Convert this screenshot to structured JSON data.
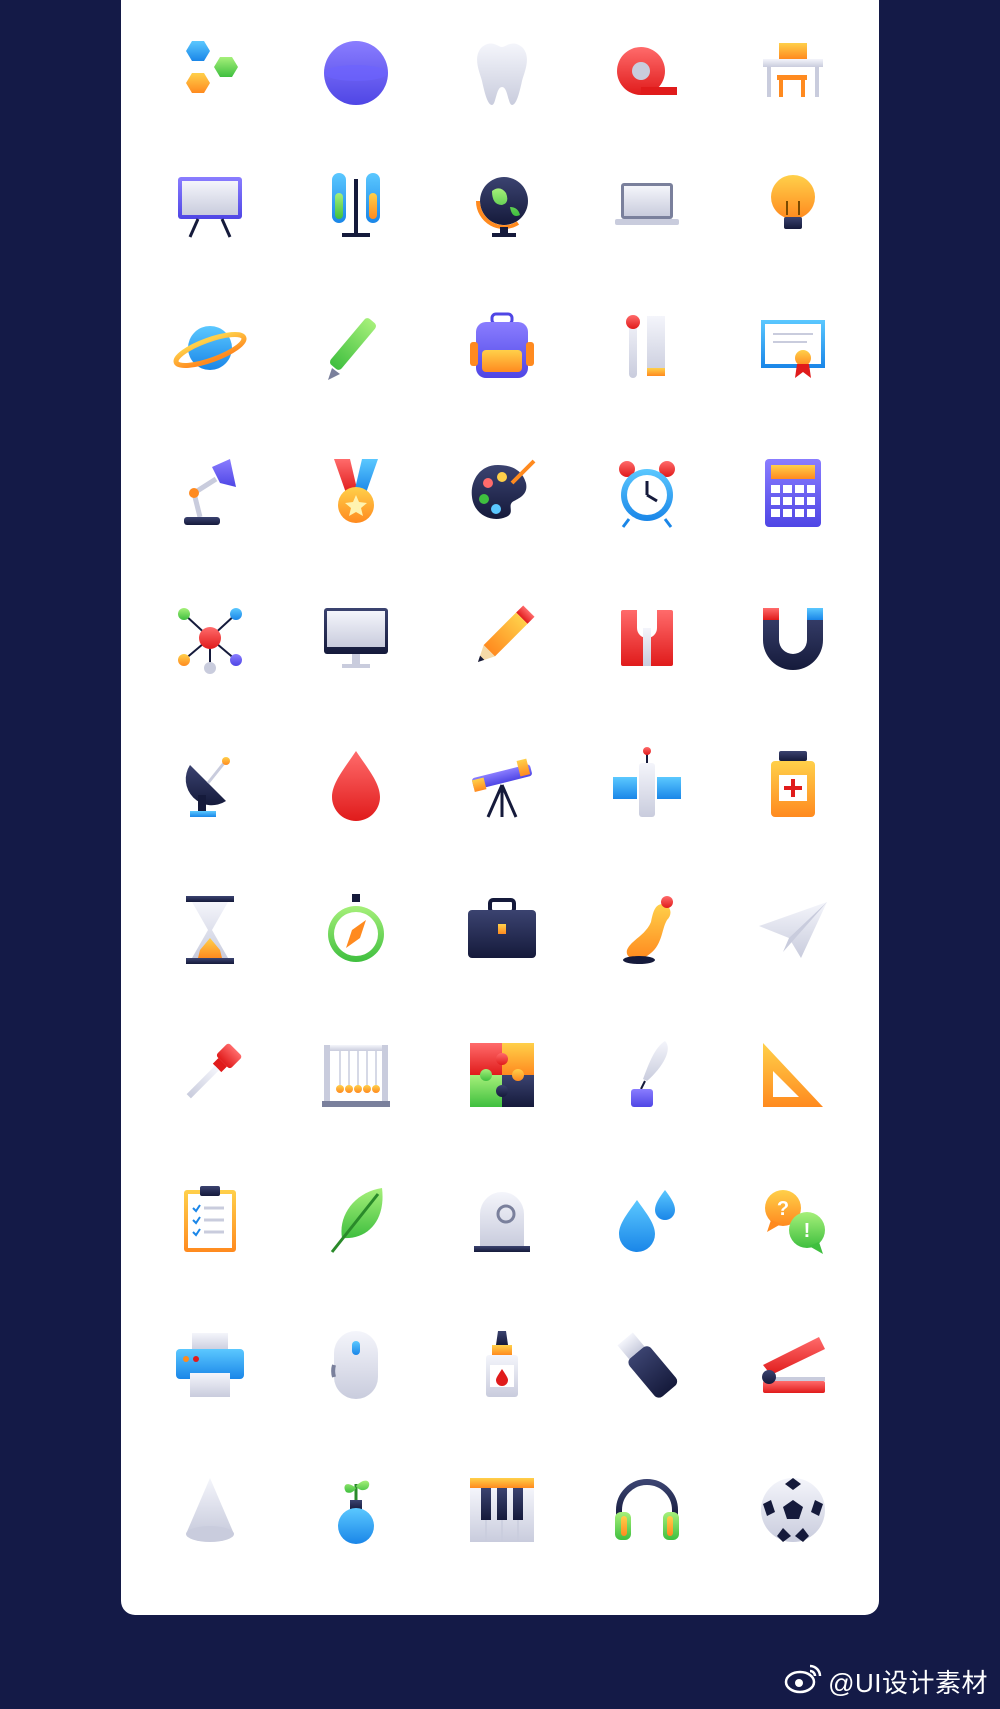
{
  "theme": {
    "background": "#141a47",
    "card": "#ffffff"
  },
  "watermark": {
    "text": "@UI设计素材",
    "icon": "weibo-icon"
  },
  "icons": [
    "hexagons-icon",
    "sphere-icon",
    "tooth-icon",
    "tape-icon",
    "desk-icon",
    "whiteboard-icon",
    "test-tubes-icon",
    "globe-icon",
    "laptop-icon",
    "lightbulb-icon",
    "planet-icon",
    "pen-icon",
    "backpack-icon",
    "thermometer-ruler-icon",
    "certificate-icon",
    "desk-lamp-icon",
    "medal-icon",
    "paint-palette-icon",
    "alarm-clock-icon",
    "calculator-icon",
    "molecule-icon",
    "monitor-icon",
    "pencil-icon",
    "sharpener-icon",
    "magnet-icon",
    "satellite-dish-icon",
    "blood-drop-icon",
    "telescope-icon",
    "satellite-icon",
    "medicine-jar-icon",
    "hourglass-icon",
    "compass-icon",
    "briefcase-icon",
    "rubber-chicken-icon",
    "paper-plane-icon",
    "pipette-icon",
    "newtons-cradle-icon",
    "puzzle-icon",
    "quill-ink-icon",
    "set-square-icon",
    "clipboard-icon",
    "leaf-icon",
    "bell-jar-icon",
    "water-drops-icon",
    "question-chat-icon",
    "printer-icon",
    "computer-mouse-icon",
    "glue-bottle-icon",
    "usb-drive-icon",
    "stapler-icon",
    "cone-icon",
    "plant-flask-icon",
    "piano-keys-icon",
    "headphones-icon",
    "soccer-ball-icon"
  ]
}
